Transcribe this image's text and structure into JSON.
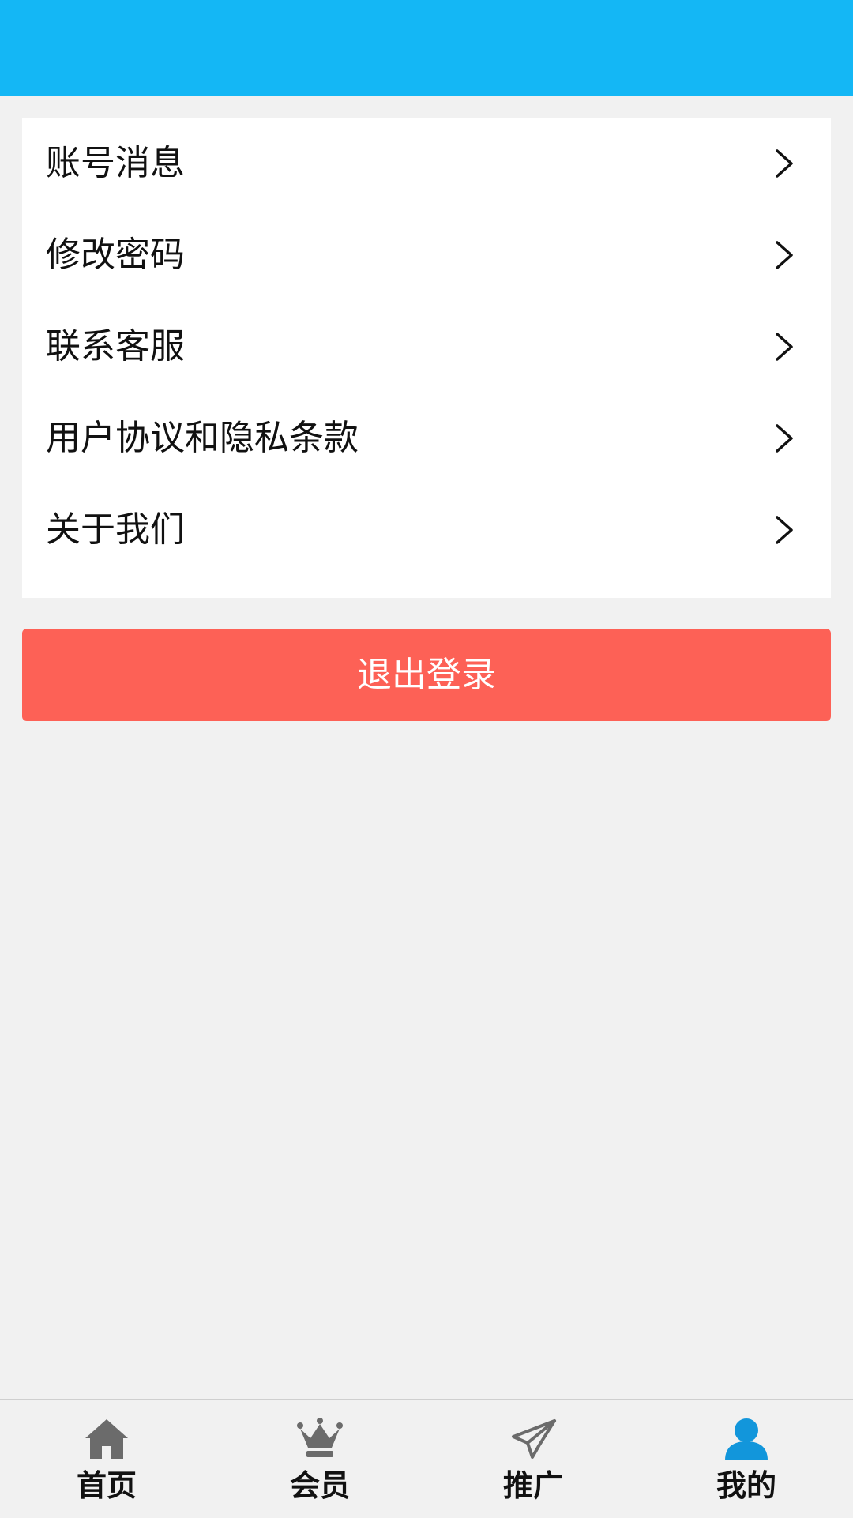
{
  "menu": {
    "items": [
      {
        "label": "账号消息",
        "icon": "chevron-right-icon"
      },
      {
        "label": "修改密码",
        "icon": "chevron-right-icon"
      },
      {
        "label": "联系客服",
        "icon": "chevron-right-icon"
      },
      {
        "label": "用户协议和隐私条款",
        "icon": "chevron-right-icon"
      },
      {
        "label": "关于我们",
        "icon": "chevron-right-icon"
      }
    ]
  },
  "logout": {
    "label": "退出登录"
  },
  "tabbar": {
    "tabs": [
      {
        "label": "首页",
        "icon": "home-icon",
        "active": false
      },
      {
        "label": "会员",
        "icon": "crown-icon",
        "active": false
      },
      {
        "label": "推广",
        "icon": "paper-plane-icon",
        "active": false
      },
      {
        "label": "我的",
        "icon": "user-icon",
        "active": true
      }
    ]
  },
  "colors": {
    "header": "#14b7f5",
    "logout_button": "#fd6156",
    "background": "#f1f1f1",
    "tab_icon_inactive": "#6b6b6b",
    "tab_icon_active": "#1296db"
  }
}
